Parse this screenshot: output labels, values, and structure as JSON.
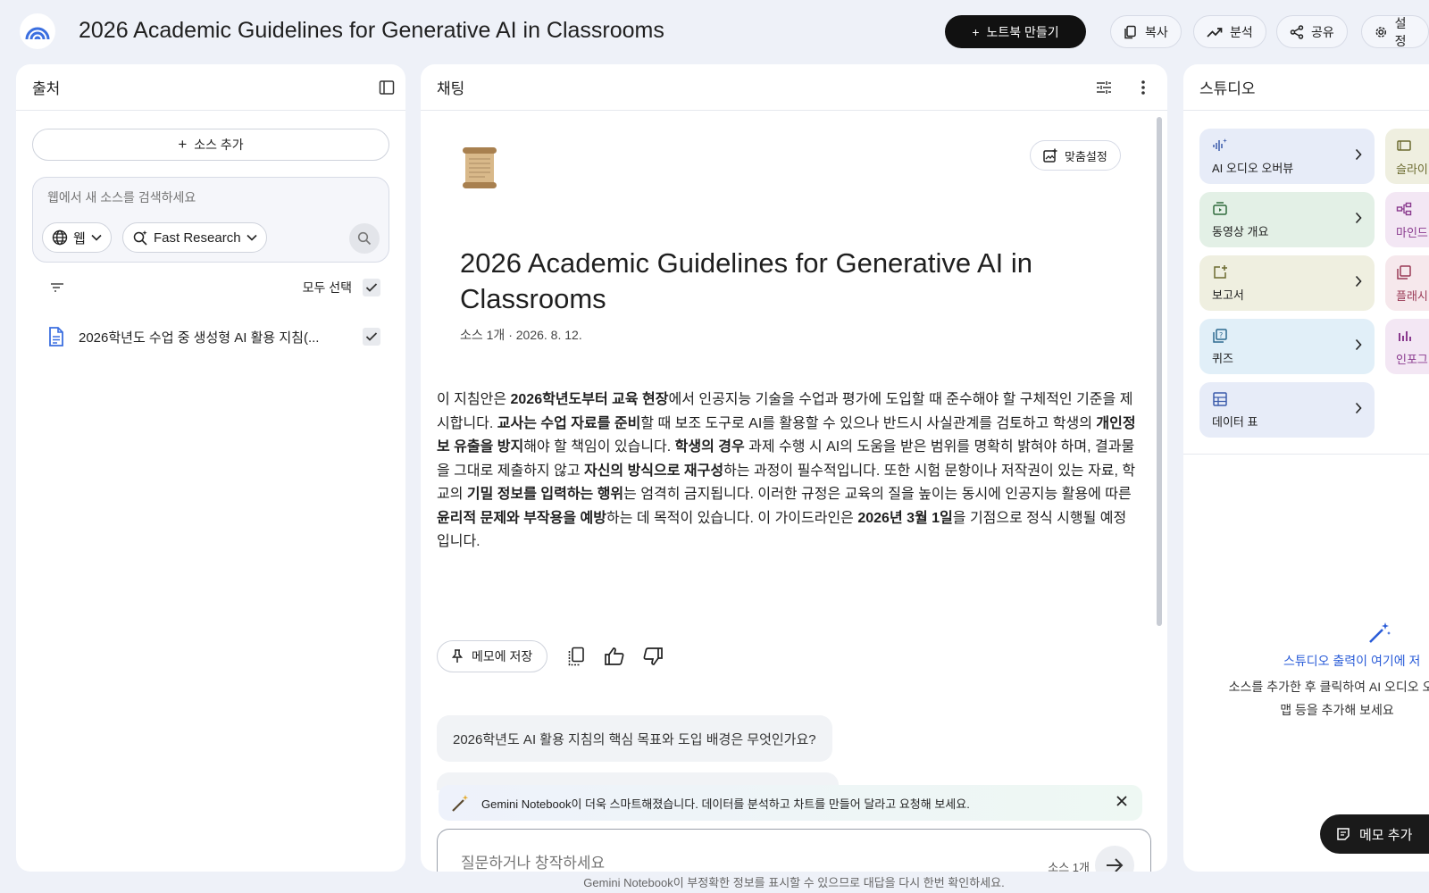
{
  "header": {
    "title": "2026 Academic Guidelines for Generative AI in Classrooms",
    "create_notebook": "노트북 만들기",
    "copy": "복사",
    "analyze": "분석",
    "share": "공유",
    "settings": "설정"
  },
  "sources": {
    "title": "출처",
    "add_source": "소스 추가",
    "search_placeholder": "웹에서 새 소스를 검색하세요",
    "chip_web": "웹",
    "chip_research": "Fast Research",
    "select_all": "모두 선택",
    "items": [
      {
        "name": "2026학년도 수업 중 생성형 AI 활용 지침(..."
      }
    ]
  },
  "chat": {
    "title": "채팅",
    "customize": "맞춤설정",
    "doc_title": "2026 Academic Guidelines for Generative AI in Classrooms",
    "doc_meta": "소스 1개 · 2026. 8. 12.",
    "summary": [
      {
        "t": "이 지침안은 "
      },
      {
        "t": "2026학년도부터 교육 현장",
        "b": true
      },
      {
        "t": "에서 인공지능 기술을 수업과 평가에 도입할 때 준수해야 할 구체적인 기준을 제시합니다. "
      },
      {
        "t": "교사는 수업 자료를 준비",
        "b": true
      },
      {
        "t": "할 때 보조 도구로 AI를 활용할 수 있으나 반드시 사실관계를 검토하고 학생의 "
      },
      {
        "t": "개인정보 유출을 방지",
        "b": true
      },
      {
        "t": "해야 할 책임이 있습니다. "
      },
      {
        "t": "학생의 경우",
        "b": true
      },
      {
        "t": " 과제 수행 시 AI의 도움을 받은 범위를 명확히 밝혀야 하며, 결과물을 그대로 제출하지 않고 "
      },
      {
        "t": "자신의 방식으로 재구성",
        "b": true
      },
      {
        "t": "하는 과정이 필수적입니다. 또한 시험 문항이나 저작권이 있는 자료, 학교의 "
      },
      {
        "t": "기밀 정보를 입력하는 행위",
        "b": true
      },
      {
        "t": "는 엄격히 금지됩니다. 이러한 규정은 교육의 질을 높이는 동시에 인공지능 활용에 따른 "
      },
      {
        "t": "윤리적 문제와 부작용을 예방",
        "b": true
      },
      {
        "t": "하는 데 목적이 있습니다. 이 가이드라인은 "
      },
      {
        "t": "2026년 3월 1일",
        "b": true
      },
      {
        "t": "을 기점으로 정식 시행될 예정입니다."
      }
    ],
    "save_memo": "메모에 저장",
    "suggestion": "2026학년도 AI 활용 지침의 핵심 목표와 도입 배경은 무엇인가요?",
    "banner": "Gemini Notebook이 더욱 스마트해졌습니다. 데이터를 분석하고 차트를 만들어 달라고 요청해 보세요.",
    "composer_placeholder": "질문하거나 창작하세요",
    "source_count": "소스 1개",
    "disclaimer": "Gemini Notebook이 부정확한 정보를 표시할 수 있으므로 대답을 다시 한번 확인하세요."
  },
  "studio": {
    "title": "스튜디오",
    "tiles": [
      {
        "label": "AI 오디오 오버뷰",
        "bg": "#e7ecf8",
        "icon_color": "#3b5bab"
      },
      {
        "label": "동영상 개요",
        "bg": "#e3f0e6",
        "icon_color": "#2f6b3c"
      },
      {
        "label": "보고서",
        "bg": "#efefe0",
        "icon_color": "#6b6a2f"
      },
      {
        "label": "퀴즈",
        "bg": "#e1eff8",
        "icon_color": "#2d6a8f"
      },
      {
        "label": "데이터 표",
        "bg": "#e7ecf8",
        "icon_color": "#3b5bab"
      }
    ],
    "tiles_b": [
      {
        "label": "슬라이",
        "bg": "#efefe0"
      },
      {
        "label": "마인드",
        "bg": "#f3e7f4"
      },
      {
        "label": "플래시",
        "bg": "#f6e8ec"
      },
      {
        "label": "인포그",
        "bg": "#f3e7f4"
      }
    ],
    "empty_title": "스튜디오 출력이 여기에 저",
    "empty_desc_1": "소스를 추가한 후 클릭하여 AI 오디오 오버",
    "empty_desc_2": "맵 등을 추가해 보세요",
    "add_memo": "메모 추가"
  }
}
